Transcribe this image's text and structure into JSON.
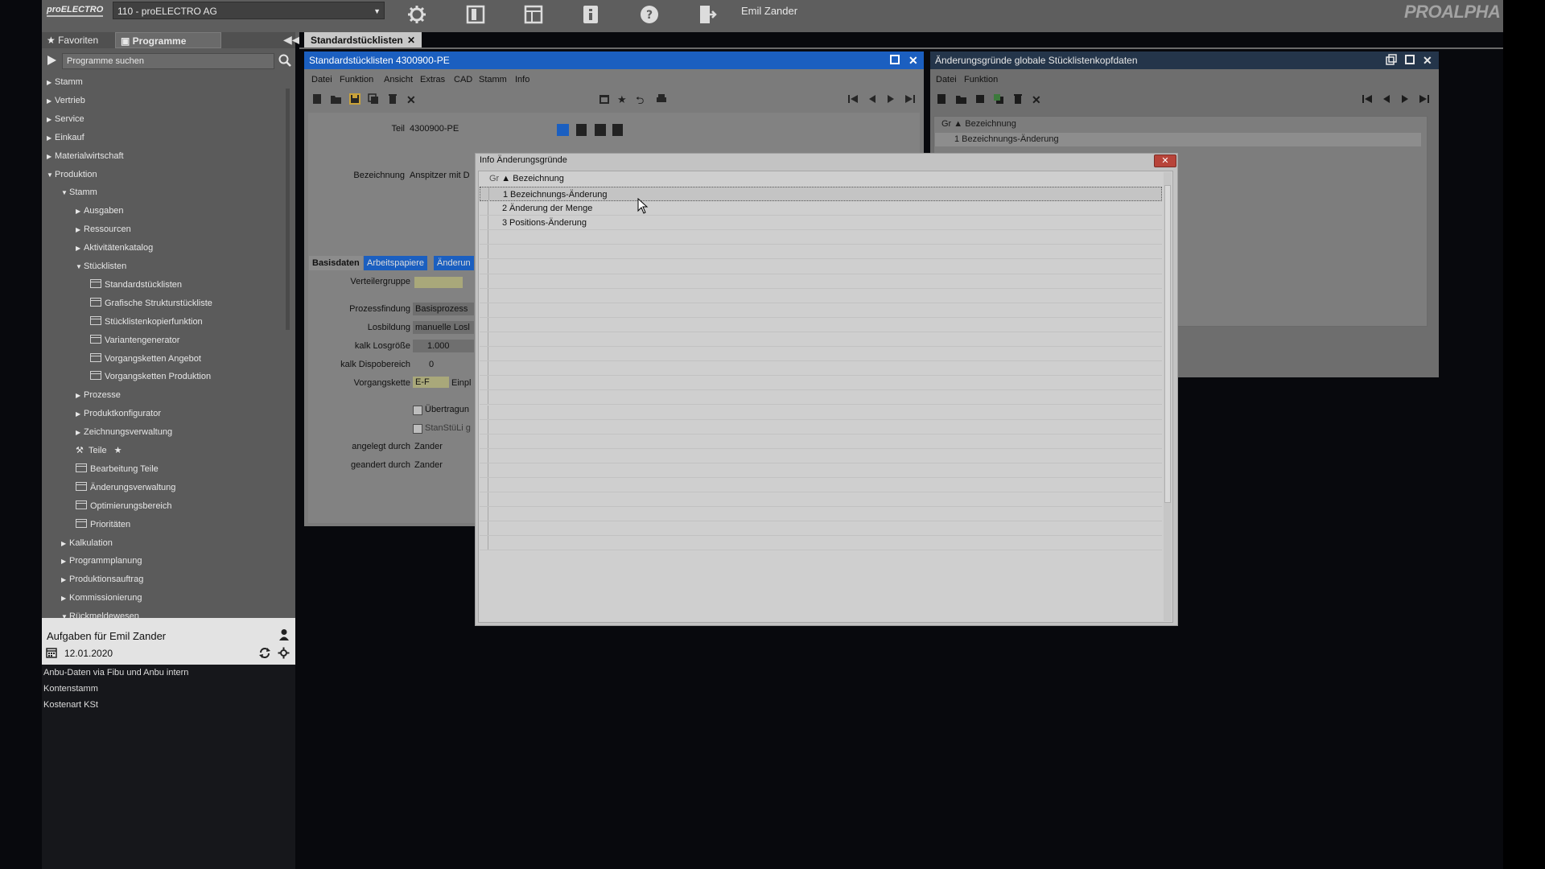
{
  "app": {
    "logo": "proELECTRO",
    "company_select": "110 - proELECTRO AG",
    "user": "Emil Zander",
    "brand": "PROALPHA"
  },
  "left_panel": {
    "tabs": [
      "Favoriten",
      "Programme"
    ],
    "search_placeholder": "Programme suchen",
    "tree": [
      {
        "label": "Stamm",
        "level": 0,
        "toggle": "▶"
      },
      {
        "label": "Vertrieb",
        "level": 0,
        "toggle": "▶"
      },
      {
        "label": "Service",
        "level": 0,
        "toggle": "▶"
      },
      {
        "label": "Einkauf",
        "level": 0,
        "toggle": "▶"
      },
      {
        "label": "Materialwirtschaft",
        "level": 0,
        "toggle": "▶"
      },
      {
        "label": "Produktion",
        "level": 0,
        "toggle": "▼"
      },
      {
        "label": "Stamm",
        "level": 1,
        "toggle": "▼"
      },
      {
        "label": "Ausgaben",
        "level": 2,
        "toggle": "▶"
      },
      {
        "label": "Ressourcen",
        "level": 2,
        "toggle": "▶"
      },
      {
        "label": "Aktivitätenkatalog",
        "level": 2,
        "toggle": "▶"
      },
      {
        "label": "Stücklisten",
        "level": 2,
        "toggle": "▼"
      },
      {
        "label": "Standardstücklisten",
        "level": 3,
        "toggle": "win"
      },
      {
        "label": "Grafische Strukturstückliste",
        "level": 3,
        "toggle": "win"
      },
      {
        "label": "Stücklistenkopierfunktion",
        "level": 3,
        "toggle": "win"
      },
      {
        "label": "Variantengenerator",
        "level": 3,
        "toggle": "win"
      },
      {
        "label": "Vorgangsketten Angebot",
        "level": 3,
        "toggle": "win"
      },
      {
        "label": "Vorgangsketten Produktion",
        "level": 3,
        "toggle": "win"
      },
      {
        "label": "Prozesse",
        "level": 2,
        "toggle": "▶"
      },
      {
        "label": "Produktkonfigurator",
        "level": 2,
        "toggle": "▶"
      },
      {
        "label": "Zeichnungsverwaltung",
        "level": 2,
        "toggle": "▶"
      },
      {
        "label": "Teile",
        "level": 2,
        "toggle": "tool"
      },
      {
        "label": "Bearbeitung Teile",
        "level": 2,
        "toggle": "win"
      },
      {
        "label": "Änderungsverwaltung",
        "level": 2,
        "toggle": "win"
      },
      {
        "label": "Optimierungsbereich",
        "level": 2,
        "toggle": "win"
      },
      {
        "label": "Prioritäten",
        "level": 2,
        "toggle": "win"
      },
      {
        "label": "Kalkulation",
        "level": 1,
        "toggle": "▶"
      },
      {
        "label": "Programmplanung",
        "level": 1,
        "toggle": "▶"
      },
      {
        "label": "Produktionsauftrag",
        "level": 1,
        "toggle": "▶"
      },
      {
        "label": "Kommissionierung",
        "level": 1,
        "toggle": "▶"
      },
      {
        "label": "Rückmeldewesen",
        "level": 1,
        "toggle": "▼"
      }
    ]
  },
  "tasks": {
    "title": "Aufgaben für Emil Zander",
    "date": "12.01.2020",
    "items": [
      "Anbu-Daten via Fibu und Anbu intern",
      "Kontenstamm",
      "Kostenart KSt"
    ]
  },
  "doc_tab": {
    "label": "Standardstücklisten"
  },
  "win1": {
    "title": "Standardstücklisten 4300900-PE",
    "menu": [
      "Datei",
      "Funktion",
      "Ansicht",
      "Extras",
      "CAD",
      "Stamm",
      "Info"
    ],
    "part_label": "Teil",
    "part_value": "4300900-PE",
    "bez_label": "Bezeichnung",
    "bez_value": "Anspitzer mit D",
    "subtabs": [
      "Basisdaten",
      "Arbeitspapiere",
      "Änderun"
    ],
    "fields": {
      "verteilergruppe": "Verteilergruppe",
      "prozessfindung": "Prozessfindung",
      "prozessfindung_val": "Basisprozess",
      "losbildung": "Losbildung",
      "losbildung_val": "manuelle Losl",
      "kalk_losgroesse": "kalk Losgröße",
      "kalk_losgroesse_val": "1.000",
      "kalk_dispo": "kalk Dispobereich",
      "kalk_dispo_val": "0",
      "vorgangskette": "Vorgangskette",
      "vorgangskette_val": "E-F",
      "vorgangskette_extra": "Einpl",
      "uebertragung": "Übertragun",
      "stanstueli": "StanStüLi g",
      "angelegt": "angelegt durch",
      "angelegt_val": "Zander",
      "geaendert": "geandert durch",
      "geaendert_val": "Zander"
    }
  },
  "win2": {
    "title": "Änderungsgründe globale Stücklistenkopfdaten",
    "menu": [
      "Datei",
      "Funktion"
    ],
    "col_gr": "Gr",
    "col_bez": "Bezeichnung",
    "row1": "1 Bezeichnungs-Änderung"
  },
  "dialog": {
    "title": "Info Änderungsgründe",
    "close": "✕",
    "col_gr": "Gr",
    "col_bez": "Bezeichnung",
    "rows": [
      {
        "nr": "1",
        "label": "Bezeichnungs-Änderung"
      },
      {
        "nr": "2",
        "label": "Änderung der Menge"
      },
      {
        "nr": "3",
        "label": "Positions-Änderung"
      }
    ]
  }
}
